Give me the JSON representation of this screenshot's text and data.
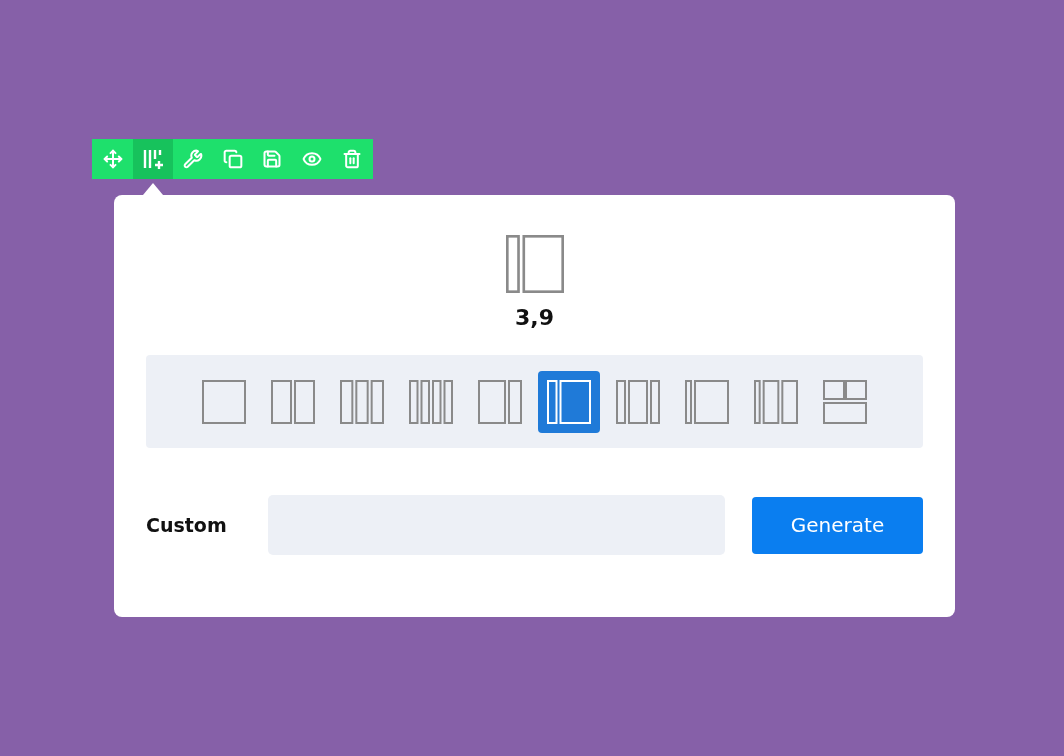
{
  "toolbar": [
    {
      "kind": "move",
      "selected": false
    },
    {
      "kind": "columns",
      "selected": true
    },
    {
      "kind": "tools",
      "selected": false
    },
    {
      "kind": "duplicate",
      "selected": false
    },
    {
      "kind": "save",
      "selected": false
    },
    {
      "kind": "visibility",
      "selected": false
    },
    {
      "kind": "delete",
      "selected": false
    }
  ],
  "preview": {
    "label": "3,9"
  },
  "layouts": [
    {
      "kind": "full",
      "selected": false
    },
    {
      "kind": "halves",
      "selected": false
    },
    {
      "kind": "thirds",
      "selected": false
    },
    {
      "kind": "quarters",
      "selected": false
    },
    {
      "kind": "wideleft",
      "selected": false
    },
    {
      "kind": "sidebar",
      "selected": true
    },
    {
      "kind": "centered",
      "selected": false
    },
    {
      "kind": "narrowleft",
      "selected": false
    },
    {
      "kind": "narrowthirds",
      "selected": false
    },
    {
      "kind": "grid",
      "selected": false
    }
  ],
  "custom": {
    "label": "Custom"
  },
  "generate_button": "Generate"
}
